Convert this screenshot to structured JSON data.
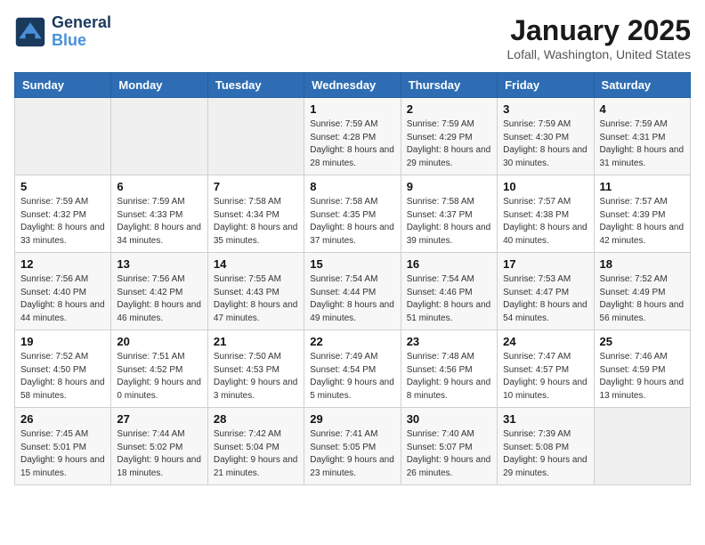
{
  "header": {
    "logo_line1": "General",
    "logo_line2": "Blue",
    "month": "January 2025",
    "location": "Lofall, Washington, United States"
  },
  "weekdays": [
    "Sunday",
    "Monday",
    "Tuesday",
    "Wednesday",
    "Thursday",
    "Friday",
    "Saturday"
  ],
  "weeks": [
    [
      {
        "day": "",
        "sunrise": "",
        "sunset": "",
        "daylight": ""
      },
      {
        "day": "",
        "sunrise": "",
        "sunset": "",
        "daylight": ""
      },
      {
        "day": "",
        "sunrise": "",
        "sunset": "",
        "daylight": ""
      },
      {
        "day": "1",
        "sunrise": "7:59 AM",
        "sunset": "4:28 PM",
        "daylight": "8 hours and 28 minutes."
      },
      {
        "day": "2",
        "sunrise": "7:59 AM",
        "sunset": "4:29 PM",
        "daylight": "8 hours and 29 minutes."
      },
      {
        "day": "3",
        "sunrise": "7:59 AM",
        "sunset": "4:30 PM",
        "daylight": "8 hours and 30 minutes."
      },
      {
        "day": "4",
        "sunrise": "7:59 AM",
        "sunset": "4:31 PM",
        "daylight": "8 hours and 31 minutes."
      }
    ],
    [
      {
        "day": "5",
        "sunrise": "7:59 AM",
        "sunset": "4:32 PM",
        "daylight": "8 hours and 33 minutes."
      },
      {
        "day": "6",
        "sunrise": "7:59 AM",
        "sunset": "4:33 PM",
        "daylight": "8 hours and 34 minutes."
      },
      {
        "day": "7",
        "sunrise": "7:58 AM",
        "sunset": "4:34 PM",
        "daylight": "8 hours and 35 minutes."
      },
      {
        "day": "8",
        "sunrise": "7:58 AM",
        "sunset": "4:35 PM",
        "daylight": "8 hours and 37 minutes."
      },
      {
        "day": "9",
        "sunrise": "7:58 AM",
        "sunset": "4:37 PM",
        "daylight": "8 hours and 39 minutes."
      },
      {
        "day": "10",
        "sunrise": "7:57 AM",
        "sunset": "4:38 PM",
        "daylight": "8 hours and 40 minutes."
      },
      {
        "day": "11",
        "sunrise": "7:57 AM",
        "sunset": "4:39 PM",
        "daylight": "8 hours and 42 minutes."
      }
    ],
    [
      {
        "day": "12",
        "sunrise": "7:56 AM",
        "sunset": "4:40 PM",
        "daylight": "8 hours and 44 minutes."
      },
      {
        "day": "13",
        "sunrise": "7:56 AM",
        "sunset": "4:42 PM",
        "daylight": "8 hours and 46 minutes."
      },
      {
        "day": "14",
        "sunrise": "7:55 AM",
        "sunset": "4:43 PM",
        "daylight": "8 hours and 47 minutes."
      },
      {
        "day": "15",
        "sunrise": "7:54 AM",
        "sunset": "4:44 PM",
        "daylight": "8 hours and 49 minutes."
      },
      {
        "day": "16",
        "sunrise": "7:54 AM",
        "sunset": "4:46 PM",
        "daylight": "8 hours and 51 minutes."
      },
      {
        "day": "17",
        "sunrise": "7:53 AM",
        "sunset": "4:47 PM",
        "daylight": "8 hours and 54 minutes."
      },
      {
        "day": "18",
        "sunrise": "7:52 AM",
        "sunset": "4:49 PM",
        "daylight": "8 hours and 56 minutes."
      }
    ],
    [
      {
        "day": "19",
        "sunrise": "7:52 AM",
        "sunset": "4:50 PM",
        "daylight": "8 hours and 58 minutes."
      },
      {
        "day": "20",
        "sunrise": "7:51 AM",
        "sunset": "4:52 PM",
        "daylight": "9 hours and 0 minutes."
      },
      {
        "day": "21",
        "sunrise": "7:50 AM",
        "sunset": "4:53 PM",
        "daylight": "9 hours and 3 minutes."
      },
      {
        "day": "22",
        "sunrise": "7:49 AM",
        "sunset": "4:54 PM",
        "daylight": "9 hours and 5 minutes."
      },
      {
        "day": "23",
        "sunrise": "7:48 AM",
        "sunset": "4:56 PM",
        "daylight": "9 hours and 8 minutes."
      },
      {
        "day": "24",
        "sunrise": "7:47 AM",
        "sunset": "4:57 PM",
        "daylight": "9 hours and 10 minutes."
      },
      {
        "day": "25",
        "sunrise": "7:46 AM",
        "sunset": "4:59 PM",
        "daylight": "9 hours and 13 minutes."
      }
    ],
    [
      {
        "day": "26",
        "sunrise": "7:45 AM",
        "sunset": "5:01 PM",
        "daylight": "9 hours and 15 minutes."
      },
      {
        "day": "27",
        "sunrise": "7:44 AM",
        "sunset": "5:02 PM",
        "daylight": "9 hours and 18 minutes."
      },
      {
        "day": "28",
        "sunrise": "7:42 AM",
        "sunset": "5:04 PM",
        "daylight": "9 hours and 21 minutes."
      },
      {
        "day": "29",
        "sunrise": "7:41 AM",
        "sunset": "5:05 PM",
        "daylight": "9 hours and 23 minutes."
      },
      {
        "day": "30",
        "sunrise": "7:40 AM",
        "sunset": "5:07 PM",
        "daylight": "9 hours and 26 minutes."
      },
      {
        "day": "31",
        "sunrise": "7:39 AM",
        "sunset": "5:08 PM",
        "daylight": "9 hours and 29 minutes."
      },
      {
        "day": "",
        "sunrise": "",
        "sunset": "",
        "daylight": ""
      }
    ]
  ]
}
